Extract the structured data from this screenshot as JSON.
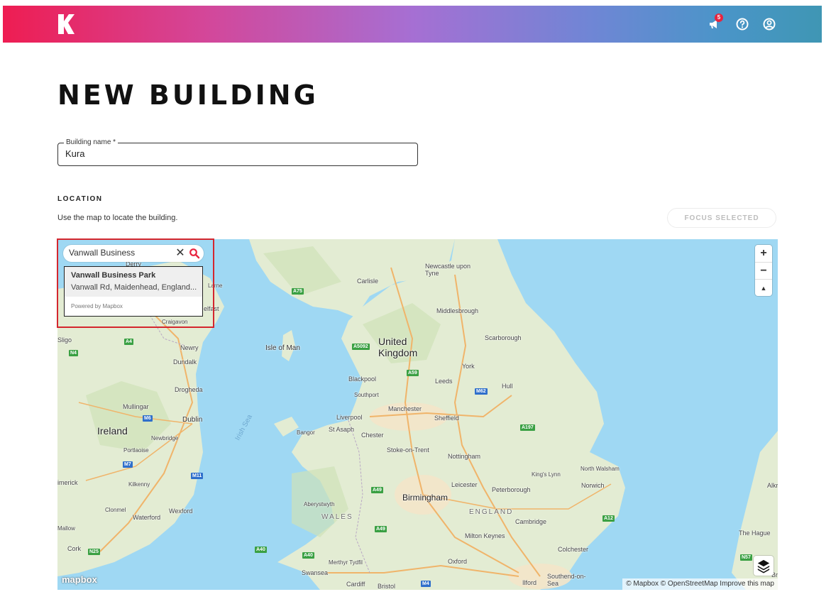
{
  "header": {
    "notifications_count": "5",
    "icons": [
      "logo-k-icon",
      "megaphone-icon",
      "help-icon",
      "account-icon"
    ]
  },
  "page": {
    "title": "NEW BUILDING"
  },
  "building_name": {
    "label": "Building name *",
    "value": "Kura"
  },
  "location": {
    "title": "LOCATION",
    "hint": "Use the map to locate the building.",
    "focus_button": "FOCUS SELECTED"
  },
  "search": {
    "query": "Vanwall Business",
    "result_title": "Vanwall Business Park",
    "result_subtitle": "Vanwall Rd, Maidenhead, England...",
    "powered_by": "Powered by Mapbox"
  },
  "map": {
    "zoom_in": "+",
    "zoom_out": "−",
    "compass": "▲",
    "logo": "mapbox",
    "attribution": "© Mapbox © OpenStreetMap Improve this map",
    "places": {
      "newcastle": "Newcastle upon Tyne",
      "carlisle": "Carlisle",
      "middlesbrough": "Middlesbrough",
      "scarborough": "Scarborough",
      "united_kingdom": "United Kingdom",
      "isle_of_man": "Isle of Man",
      "york": "York",
      "blackpool": "Blackpool",
      "leeds": "Leeds",
      "hull": "Hull",
      "southport": "Southport",
      "manchester": "Manchester",
      "liverpool": "Liverpool",
      "sheffield": "Sheffield",
      "bangor": "Bangor",
      "st_asaph": "St Asaph",
      "chester": "Chester",
      "stoke": "Stoke-on-Trent",
      "nottingham": "Nottingham",
      "kings_lynn": "King's Lynn",
      "north_walsham": "North Walsham",
      "leicester": "Leicester",
      "peterborough": "Peterborough",
      "norwich": "Norwich",
      "birmingham": "Birmingham",
      "aberystwyth": "Aberystwyth",
      "wales": "WALES",
      "england": "ENGLAND",
      "cambridge": "Cambridge",
      "milton_keynes": "Milton Keynes",
      "colchester": "Colchester",
      "the_hague": "The Hague",
      "oxford": "Oxford",
      "merthyr": "Merthyr Tydfil",
      "swansea": "Swansea",
      "cardiff": "Cardiff",
      "bristol": "Bristol",
      "ilford": "Ilford",
      "southend": "Southend-on-Sea",
      "ireland": "Ireland",
      "dublin": "Dublin",
      "irish_sea": "Irish Sea",
      "sligo": "Sligo",
      "newry": "Newry",
      "dundalk": "Dundalk",
      "drogheda": "Drogheda",
      "mullingar": "Mullingar",
      "newbridge": "Newbridge",
      "portlaoise": "Portlaoise",
      "limerick": "imerick",
      "kilkenny": "Kilkenny",
      "clonmel": "Clonmel",
      "waterford": "Waterford",
      "wexford": "Wexford",
      "mallow": "Mallow",
      "cork": "Cork",
      "derry": "Derry",
      "larne": "Larne",
      "belfast": "elfast",
      "craigavon": "Craigavon",
      "alkmaar": "Alkr",
      "br": "Br"
    },
    "roads": {
      "a75": "A75",
      "a4": "A4",
      "n4": "N4",
      "a5092": "A5092",
      "a59": "A59",
      "m62": "M62",
      "m6": "M6",
      "a197": "A197",
      "m7": "M7",
      "m11": "M11",
      "a49": "A49",
      "a12": "A12",
      "a49b": "A49",
      "a40": "A40",
      "a40b": "A40",
      "n25": "N25",
      "m4": "M4",
      "n57": "N57"
    }
  },
  "colors": {
    "accent_red": "#d4262e",
    "land": "#e9eedd",
    "water": "#9fd8f3",
    "header_start": "#ee1d52",
    "header_end": "#3f96b4"
  }
}
